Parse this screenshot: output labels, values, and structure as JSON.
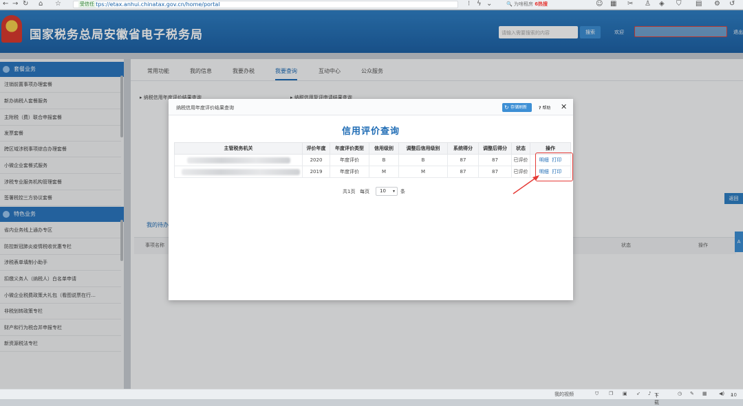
{
  "browser": {
    "secure_label": "受信任",
    "url": "https://etax.anhui.chinatax.gov.cn/home/portal",
    "search_hint": "为啥租房",
    "search_hot": "6热搜"
  },
  "header": {
    "site_title": "国家税务总局安徽省电子税务局",
    "search_placeholder": "请输入需要搜索的内容",
    "search_button": "搜索",
    "welcome": "欢迎",
    "logout": "退出"
  },
  "sidebar": {
    "section1": "套餐业务",
    "items1": [
      "注销前置事项办理套餐",
      "新办纳税人套餐服务",
      "主附税（费）联合申报套餐",
      "发票套餐",
      "跨区域涉税事项综合办理套餐",
      "小微企业套餐式服务",
      "涉税专业服务机构管理套餐",
      "签署税控三方协议套餐"
    ],
    "section2": "特色业务",
    "items2": [
      "省内业务线上通办专区",
      "防控新冠肺炎疫情税收优惠专栏",
      "涉税表单填制小助手",
      "扣缴义务人（纳税人）白名单申请",
      "小微企业税费政策大礼包（看图说票在行…",
      "非税划转政策专栏",
      "财产和行为税合并申报专栏",
      "新资源税法专栏"
    ]
  },
  "tabs": [
    "常用功能",
    "我的信息",
    "我要办税",
    "我要查询",
    "互动中心",
    "公众服务"
  ],
  "breadcrumbs": [
    "纳税信用年度评价结果查询",
    "纳税信用复评申请结果查询"
  ],
  "return_label": "返回",
  "lower": {
    "tab": "我的待办",
    "col_item": "事项名称",
    "col_status": "状态",
    "col_action": "操作",
    "side_label": "A"
  },
  "modal": {
    "title": "纳税信用年度评价结果查询",
    "refresh_label": "存储刷新",
    "help_label": "帮助",
    "close_label": "✕",
    "query_title": "信用评价查询",
    "columns": [
      "主管税务机关",
      "评价年度",
      "年度评价类型",
      "信用级别",
      "调整后信用级别",
      "系统得分",
      "调整后得分",
      "状态",
      "操作"
    ],
    "rows": [
      {
        "year": "2020",
        "type": "年度评价",
        "level": "B",
        "adj_level": "B",
        "score": "87",
        "adj_score": "87",
        "status": "已评价",
        "detail": "明细",
        "print": "打印"
      },
      {
        "year": "2019",
        "type": "年度评价",
        "level": "M",
        "adj_level": "M",
        "score": "87",
        "adj_score": "87",
        "status": "已评价",
        "detail": "明细",
        "print": "打印"
      }
    ],
    "pager": {
      "total": "共1页",
      "per_page_label": "每页",
      "per_page": "10",
      "unit": "条"
    }
  },
  "statusbar": {
    "left": "我的视频",
    "download": "下载",
    "zoom": "10"
  },
  "colors": {
    "brand_blue": "#1f6cb5",
    "header_blue": "#2f7fc4",
    "alert_red": "#e53935"
  }
}
